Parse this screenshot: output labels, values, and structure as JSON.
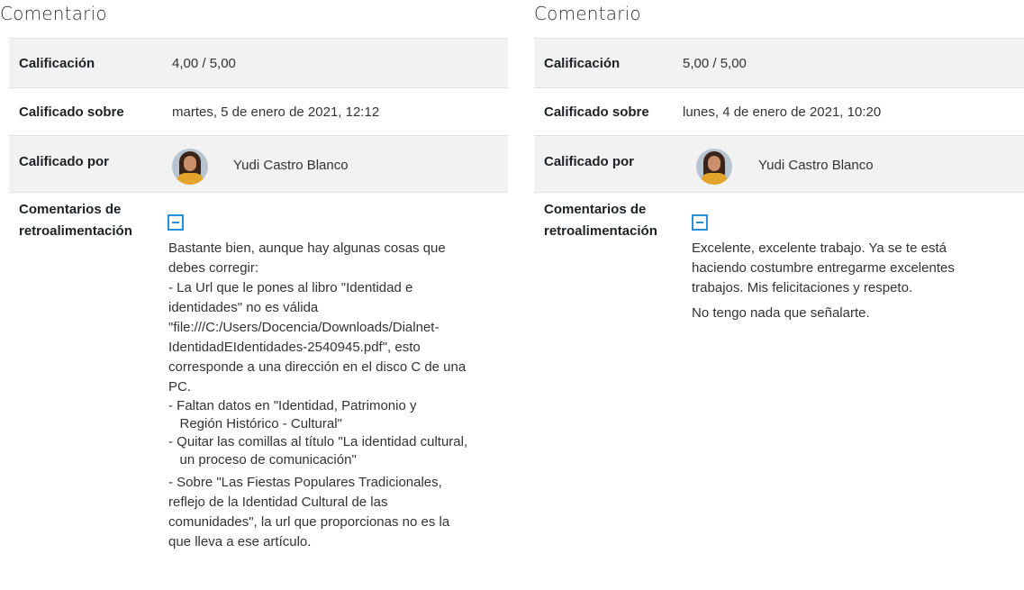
{
  "left": {
    "heading": "Comentario",
    "grade_label": "Calificación",
    "grade_value": "4,00 / 5,00",
    "graded_on_label": "Calificado sobre",
    "graded_on_value": "martes, 5 de enero de 2021, 12:12",
    "graded_by_label": "Calificado por",
    "grader_name": "Yudi Castro Blanco",
    "feedback_label_1": "Comentarios de",
    "feedback_label_2": "retroalimentación",
    "feedback_lines": [
      " Bastante bien, aunque hay algunas cosas que",
      " debes corregir:",
      "- La Url que le pones al libro \"Identidad e",
      "identidades\" no es válida",
      "\"file:///C:/Users/Docencia/Downloads/Dialnet-",
      "IdentidadEIdentidades-2540945.pdf\", esto",
      "corresponde a una dirección en el disco C de una",
      "PC.",
      "- Faltan datos en \"Identidad, Patrimonio y",
      "   Región Histórico - Cultural\"",
      "- Quitar las comillas al título \"La identidad cultural,",
      "   un proceso de comunicación\"",
      "- Sobre \"Las Fiestas Populares Tradicionales,",
      "reflejo de la Identidad Cultural de las",
      "comunidades\", la url que proporcionas no es la",
      "que lleva a ese artículo."
    ]
  },
  "right": {
    "heading": "Comentario",
    "grade_label": "Calificación",
    "grade_value": "5,00 / 5,00",
    "graded_on_label": "Calificado sobre",
    "graded_on_value": "lunes, 4 de enero de 2021, 10:20",
    "graded_by_label": "Calificado por",
    "grader_name": "Yudi Castro Blanco",
    "feedback_label_1": "Comentarios de",
    "feedback_label_2": "retroalimentación",
    "feedback_lines": [
      "Excelente, excelente trabajo. Ya se te está",
      "haciendo costumbre entregarme excelentes",
      "trabajos. Mis felicitaciones y respeto.",
      "No tengo nada que señalarte."
    ]
  }
}
